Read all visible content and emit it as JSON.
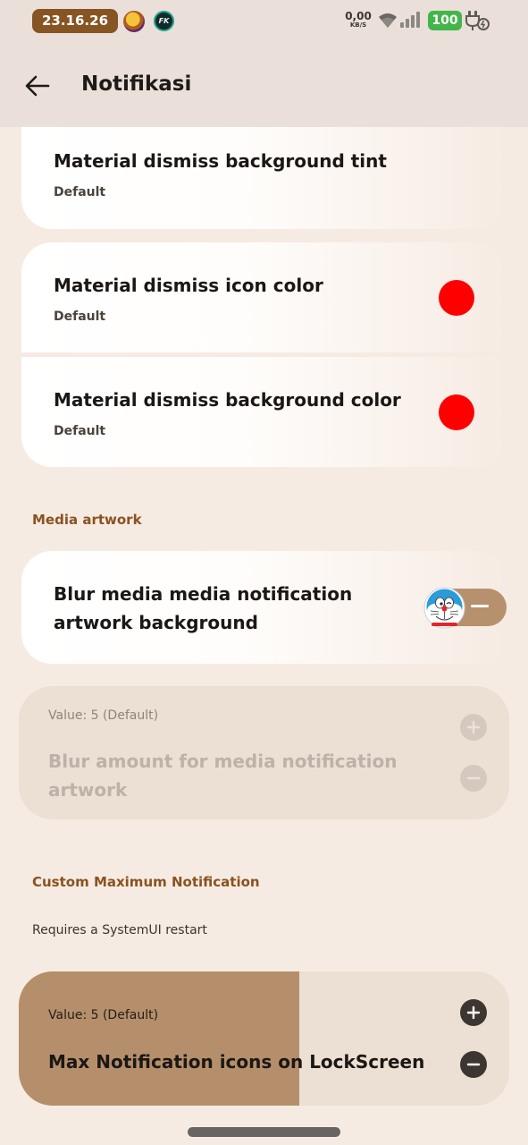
{
  "status_bar": {
    "time": "23.16.26",
    "app_badge": "FK",
    "net_speed_value": "0,00",
    "net_speed_unit": "KB/S",
    "battery": "100"
  },
  "app_bar": {
    "title": "Notifikasi",
    "back_icon": "arrow-back-icon"
  },
  "items": {
    "dismiss_bg_tint": {
      "title": "Material dismiss background tint",
      "value": "Default"
    },
    "dismiss_icon_color": {
      "title": "Material dismiss icon color",
      "value": "Default",
      "color": "#ff0000"
    },
    "dismiss_bg_color": {
      "title": "Material dismiss background color",
      "value": "Default",
      "color": "#ff0000"
    }
  },
  "sections": {
    "media_artwork": {
      "header": "Media artwork",
      "blur_toggle": {
        "title_line1": "Blur media media notification",
        "title_line2": "artwork background",
        "state": "off"
      },
      "blur_amount": {
        "value_label": "Value: 5 (Default)",
        "title_line1": "Blur amount for media notification",
        "title_line2": "artwork",
        "enabled": false
      }
    },
    "custom_max_notification": {
      "header": "Custom Maximum Notification",
      "note": "Requires a SystemUI restart",
      "max_icons": {
        "value_label": "Value: 5 (Default)",
        "title": "Max Notification icons on LockScreen",
        "fill_fraction": 0.5
      }
    }
  },
  "colors": {
    "accent": "#875423",
    "section_header": "#8a5220",
    "background": "#f6ebe3",
    "toggle_track": "#b7916d",
    "slider_fill": "#b58f6b"
  }
}
